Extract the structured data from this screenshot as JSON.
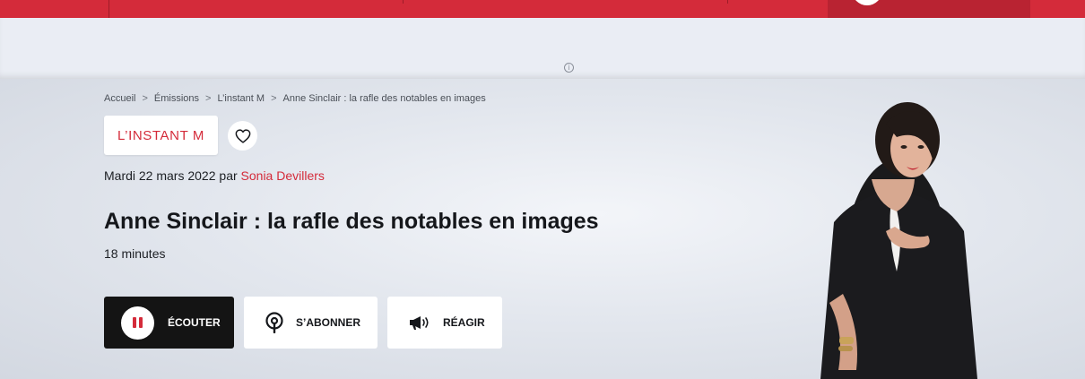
{
  "colors": {
    "accent": "#d42b3a",
    "dark_button": "#141414"
  },
  "breadcrumb": {
    "items": [
      "Accueil",
      "Émissions",
      "L’instant M",
      "Anne Sinclair : la rafle des notables en images"
    ],
    "separator": ">"
  },
  "show": {
    "tag_label": "L’INSTANT M",
    "favorite_icon": "heart-icon"
  },
  "episode": {
    "date": "Mardi 22 mars 2022",
    "by": "par",
    "author": "Sonia Devillers",
    "title": "Anne Sinclair : la rafle des notables en images",
    "duration": "18 minutes"
  },
  "actions": {
    "listen_label": "ÉCOUTER",
    "subscribe_label": "S’ABONNER",
    "react_label": "RÉAGIR"
  },
  "ad": {
    "info_icon": "ⓘ"
  }
}
